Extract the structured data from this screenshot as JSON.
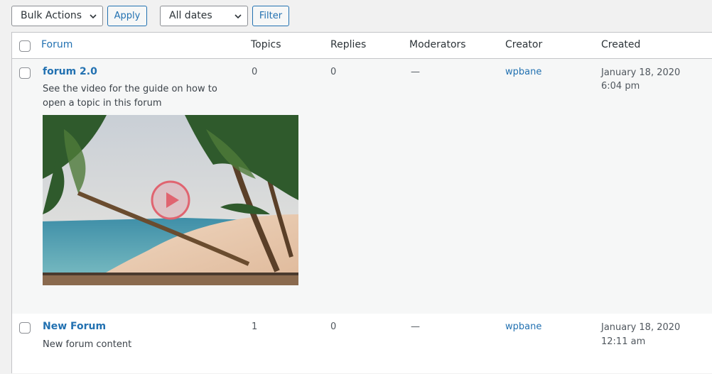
{
  "toolbar": {
    "bulk_actions": "Bulk Actions",
    "apply_label": "Apply",
    "dates": "All dates",
    "filter_label": "Filter"
  },
  "columns": {
    "forum": "Forum",
    "topics": "Topics",
    "replies": "Replies",
    "moderators": "Moderators",
    "creator": "Creator",
    "created": "Created"
  },
  "rows": [
    {
      "title": "forum 2.0",
      "description": "See the video for the guide on how to open a topic in this forum",
      "topics": "0",
      "replies": "0",
      "moderators": "—",
      "creator": "wpbane",
      "created_date": "January 18, 2020",
      "created_time": "6:04 pm",
      "video_icon": "play-icon"
    },
    {
      "title": "New Forum",
      "description": "New forum content",
      "topics": "1",
      "replies": "0",
      "moderators": "—",
      "creator": "wpbane",
      "created_date": "January 18, 2020",
      "created_time": "12:11 am"
    }
  ],
  "colors": {
    "link": "#2271b1",
    "play_accent": "#e06470"
  }
}
